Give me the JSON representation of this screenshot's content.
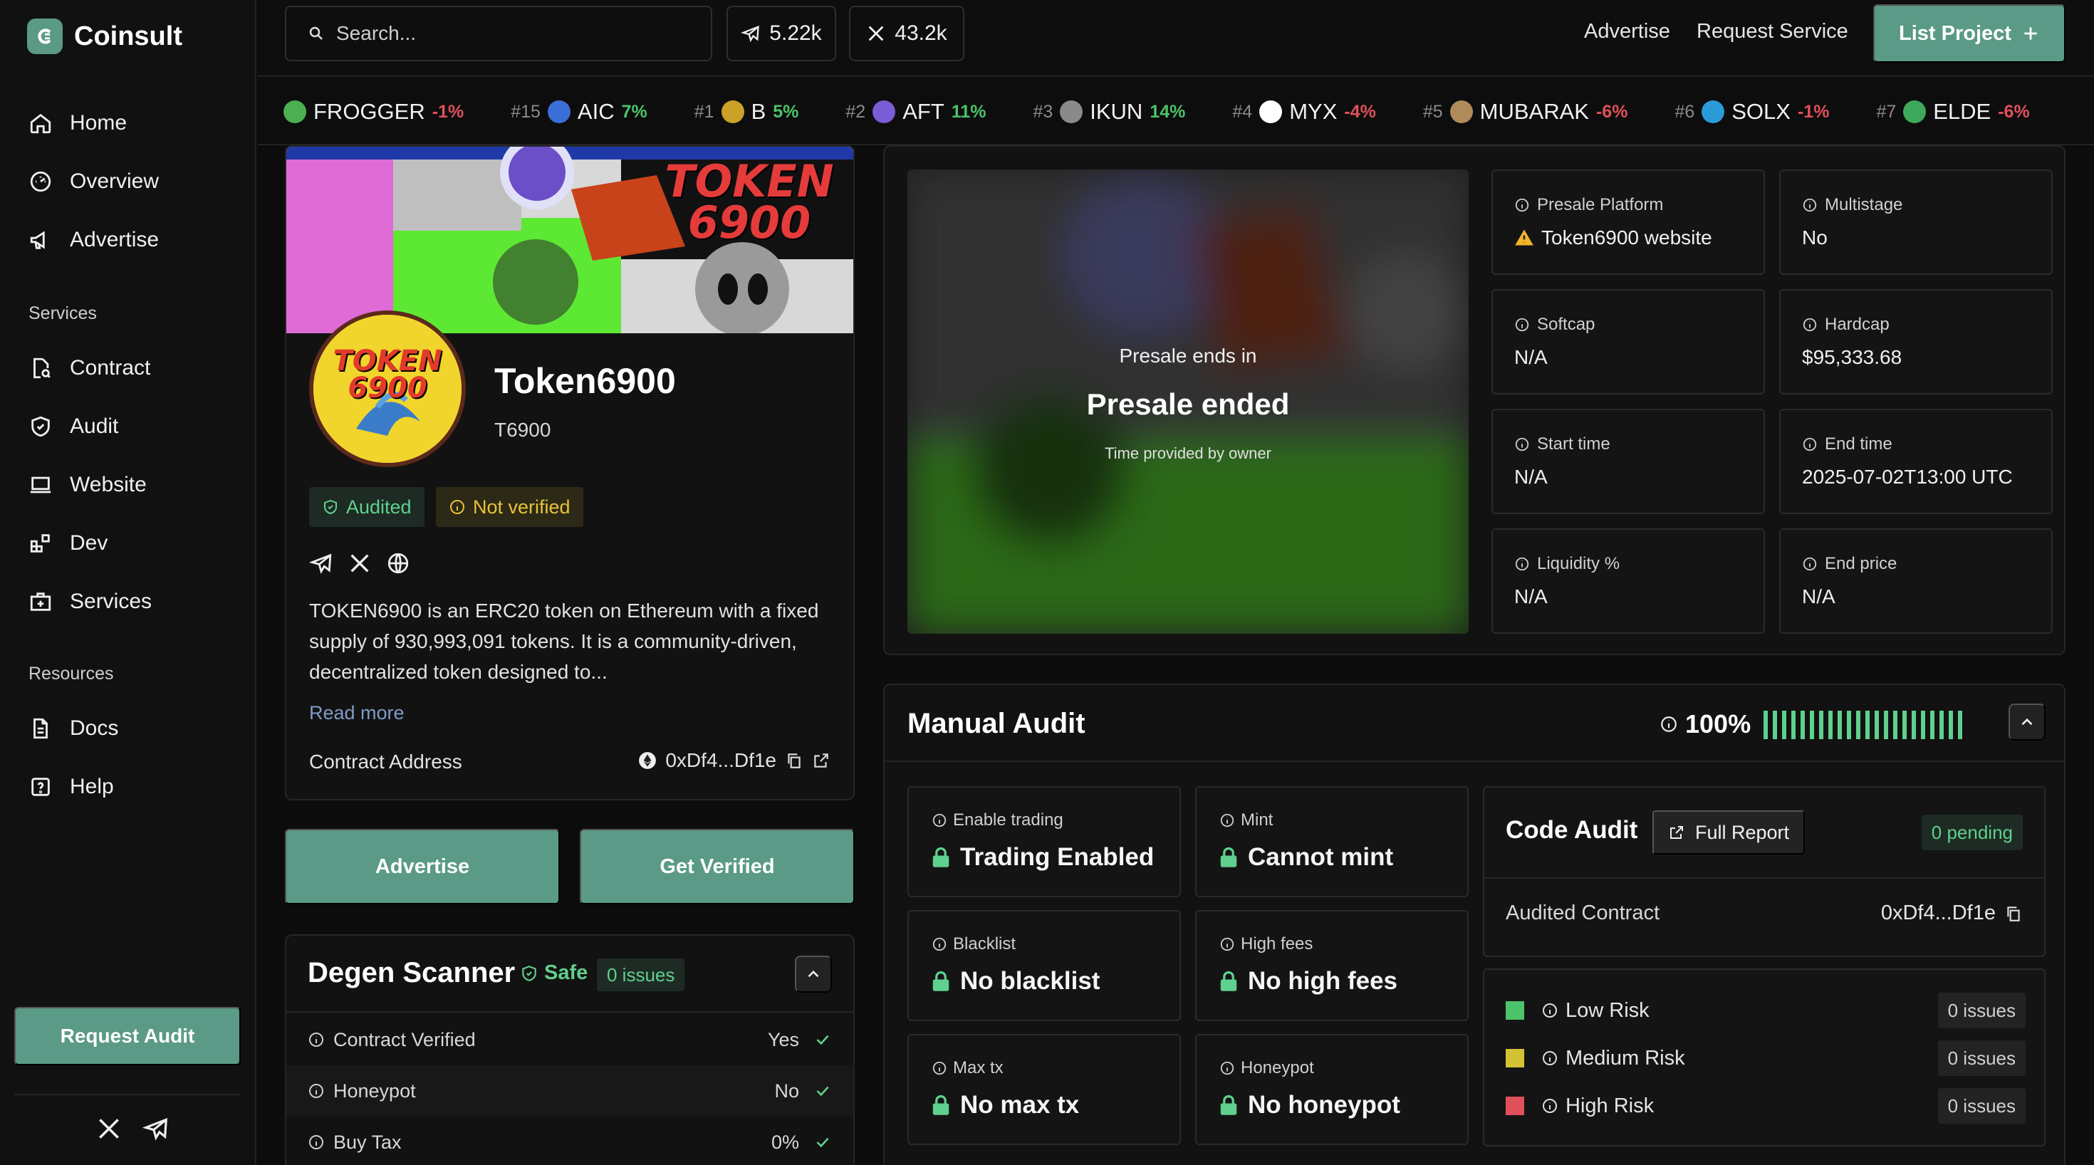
{
  "brand": {
    "name": "Coinsult",
    "accent": "#5a9a86"
  },
  "sidebar": {
    "items": [
      {
        "label": "Home",
        "icon": "home-icon"
      },
      {
        "label": "Overview",
        "icon": "gauge-icon"
      },
      {
        "label": "Advertise",
        "icon": "megaphone-icon"
      }
    ],
    "services_heading": "Services",
    "service_items": [
      {
        "label": "Contract",
        "icon": "file-search-icon"
      },
      {
        "label": "Audit",
        "icon": "shield-icon"
      },
      {
        "label": "Website",
        "icon": "laptop-icon"
      },
      {
        "label": "Dev",
        "icon": "blocks-icon"
      },
      {
        "label": "Services",
        "icon": "briefcase-plus-icon"
      }
    ],
    "resources_heading": "Resources",
    "resource_items": [
      {
        "label": "Docs",
        "icon": "document-icon"
      },
      {
        "label": "Help",
        "icon": "help-icon"
      }
    ],
    "request_audit": "Request Audit"
  },
  "topbar": {
    "search_placeholder": "Search...",
    "telegram_count": "5.22k",
    "x_count": "43.2k",
    "advertise": "Advertise",
    "request_service": "Request Service",
    "list_project": "List Project"
  },
  "ticker": [
    {
      "rank": "",
      "symbol": "FROGGER",
      "change": "-1%",
      "dir": "neg",
      "color": "#4caf50"
    },
    {
      "rank": "#15",
      "symbol": "AIC",
      "change": "7%",
      "dir": "pos",
      "color": "#3b6fd8"
    },
    {
      "rank": "#1",
      "symbol": "B",
      "change": "5%",
      "dir": "pos",
      "color": "#c9a227"
    },
    {
      "rank": "#2",
      "symbol": "AFT",
      "change": "11%",
      "dir": "pos",
      "color": "#7a5cd6"
    },
    {
      "rank": "#3",
      "symbol": "IKUN",
      "change": "14%",
      "dir": "pos",
      "color": "#8a8a8a"
    },
    {
      "rank": "#4",
      "symbol": "MYX",
      "change": "-4%",
      "dir": "neg",
      "color": "#ffffff"
    },
    {
      "rank": "#5",
      "symbol": "MUBARAK",
      "change": "-6%",
      "dir": "neg",
      "color": "#b08a5a"
    },
    {
      "rank": "#6",
      "symbol": "SOLX",
      "change": "-1%",
      "dir": "neg",
      "color": "#2a9bd8"
    },
    {
      "rank": "#7",
      "symbol": "ELDE",
      "change": "-6%",
      "dir": "neg",
      "color": "#3caa5a"
    }
  ],
  "project": {
    "name": "Token6900",
    "symbol": "T6900",
    "banner_text": "TOKEN 6900",
    "avatar_text": "TOKEN 6900",
    "badge_audited": "Audited",
    "badge_not_verified": "Not verified",
    "description": "TOKEN6900 is an ERC20 token on Ethereum with a fixed supply of 930,993,091 tokens. It is a community-driven, decentralized token designed to...",
    "read_more": "Read more",
    "contract_label": "Contract Address",
    "contract_value": "0xDf4...Df1e"
  },
  "actions": {
    "advertise": "Advertise",
    "get_verified": "Get Verified"
  },
  "degen": {
    "title": "Degen Scanner",
    "status": "Safe",
    "issues": "0 issues",
    "rows": [
      {
        "label": "Contract Verified",
        "value": "Yes"
      },
      {
        "label": "Honeypot",
        "value": "No"
      },
      {
        "label": "Buy Tax",
        "value": "0%"
      }
    ]
  },
  "presale": {
    "ends_in": "Presale ends in",
    "status": "Presale ended",
    "note": "Time provided by owner",
    "fields": [
      {
        "label": "Presale Platform",
        "value": "Token6900 website",
        "warn": true
      },
      {
        "label": "Multistage",
        "value": "No"
      },
      {
        "label": "Softcap",
        "value": "N/A"
      },
      {
        "label": "Hardcap",
        "value": "$95,333.68"
      },
      {
        "label": "Start time",
        "value": "N/A"
      },
      {
        "label": "End time",
        "value": "2025-07-02T13:00 UTC"
      },
      {
        "label": "Liquidity %",
        "value": "N/A"
      },
      {
        "label": "End price",
        "value": "N/A"
      }
    ]
  },
  "audit": {
    "title": "Manual Audit",
    "score": "100%",
    "score_fraction": 1.0,
    "checks": [
      {
        "label": "Enable trading",
        "value": "Trading Enabled"
      },
      {
        "label": "Mint",
        "value": "Cannot mint"
      },
      {
        "label": "Blacklist",
        "value": "No blacklist"
      },
      {
        "label": "High fees",
        "value": "No high fees"
      },
      {
        "label": "Max tx",
        "value": "No max tx"
      },
      {
        "label": "Honeypot",
        "value": "No honeypot"
      }
    ],
    "code_audit": {
      "title": "Code Audit",
      "full_report": "Full Report",
      "pending": "0 pending",
      "audited_contract_label": "Audited Contract",
      "audited_contract_value": "0xDf4...Df1e"
    },
    "risks": [
      {
        "label": "Low Risk",
        "count": "0 issues",
        "color": "#4cc36a"
      },
      {
        "label": "Medium Risk",
        "count": "0 issues",
        "color": "#d4c234"
      },
      {
        "label": "High Risk",
        "count": "0 issues",
        "color": "#e0505a"
      }
    ]
  }
}
